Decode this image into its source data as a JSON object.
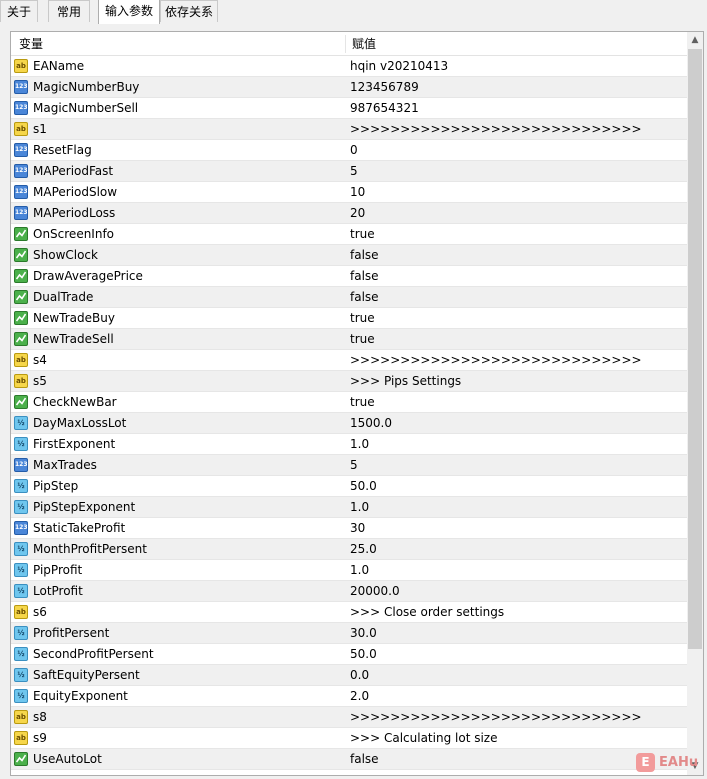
{
  "tabs": [
    {
      "label": "关于"
    },
    {
      "label": "常用"
    },
    {
      "label": "输入参数"
    },
    {
      "label": "依存关系"
    }
  ],
  "table": {
    "col_variable": "变量",
    "col_value": "赋值",
    "rows": [
      {
        "icon": "ab",
        "name": "EAName",
        "value": "hqin v20210413"
      },
      {
        "icon": "num",
        "name": "MagicNumberBuy",
        "value": "123456789"
      },
      {
        "icon": "num",
        "name": "MagicNumberSell",
        "value": "987654321"
      },
      {
        "icon": "ab",
        "name": "s1",
        "value": ">>>>>>>>>>>>>>>>>>>>>>>>>>>>>"
      },
      {
        "icon": "num",
        "name": "ResetFlag",
        "value": "0"
      },
      {
        "icon": "num",
        "name": "MAPeriodFast",
        "value": "5"
      },
      {
        "icon": "num",
        "name": "MAPeriodSlow",
        "value": "10"
      },
      {
        "icon": "num",
        "name": "MAPeriodLoss",
        "value": "20"
      },
      {
        "icon": "bool",
        "name": "OnScreenInfo",
        "value": "true"
      },
      {
        "icon": "bool",
        "name": "ShowClock",
        "value": "false"
      },
      {
        "icon": "bool",
        "name": "DrawAveragePrice",
        "value": "false"
      },
      {
        "icon": "bool",
        "name": "DualTrade",
        "value": "false"
      },
      {
        "icon": "bool",
        "name": "NewTradeBuy",
        "value": "true"
      },
      {
        "icon": "bool",
        "name": "NewTradeSell",
        "value": "true"
      },
      {
        "icon": "ab",
        "name": "s4",
        "value": ">>>>>>>>>>>>>>>>>>>>>>>>>>>>>"
      },
      {
        "icon": "ab",
        "name": "s5",
        "value": ">>> Pips Settings"
      },
      {
        "icon": "bool",
        "name": "CheckNewBar",
        "value": "true"
      },
      {
        "icon": "dbl",
        "name": "DayMaxLossLot",
        "value": "1500.0"
      },
      {
        "icon": "dbl",
        "name": "FirstExponent",
        "value": "1.0"
      },
      {
        "icon": "num",
        "name": "MaxTrades",
        "value": "5"
      },
      {
        "icon": "dbl",
        "name": "PipStep",
        "value": "50.0"
      },
      {
        "icon": "dbl",
        "name": "PipStepExponent",
        "value": "1.0"
      },
      {
        "icon": "num",
        "name": "StaticTakeProfit",
        "value": "30"
      },
      {
        "icon": "dbl",
        "name": "MonthProfitPersent",
        "value": "25.0"
      },
      {
        "icon": "dbl",
        "name": "PipProfit",
        "value": "1.0"
      },
      {
        "icon": "dbl",
        "name": "LotProfit",
        "value": "20000.0"
      },
      {
        "icon": "ab",
        "name": "s6",
        "value": ">>> Close order settings"
      },
      {
        "icon": "dbl",
        "name": "ProfitPersent",
        "value": "30.0"
      },
      {
        "icon": "dbl",
        "name": "SecondProfitPersent",
        "value": "50.0"
      },
      {
        "icon": "dbl",
        "name": "SaftEquityPersent",
        "value": "0.0"
      },
      {
        "icon": "dbl",
        "name": "EquityExponent",
        "value": "2.0"
      },
      {
        "icon": "ab",
        "name": "s8",
        "value": ">>>>>>>>>>>>>>>>>>>>>>>>>>>>>"
      },
      {
        "icon": "ab",
        "name": "s9",
        "value": ">>> Calculating lot size"
      },
      {
        "icon": "bool",
        "name": "UseAutoLot",
        "value": "false"
      }
    ]
  },
  "icon_glyphs": {
    "ab": "ab",
    "num": "123",
    "dbl": "½",
    "bool": ""
  },
  "watermark": {
    "logo": "E",
    "text": "EAHu"
  },
  "scroll": {
    "up": "▲",
    "down": "▼"
  }
}
